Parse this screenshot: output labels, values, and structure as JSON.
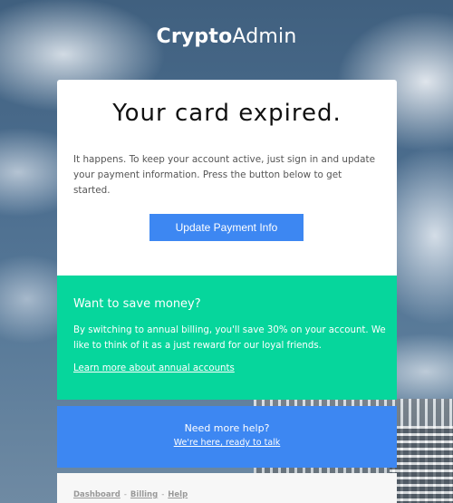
{
  "brand": {
    "bold": "Crypto",
    "light": "Admin"
  },
  "card": {
    "title": "Your card expired.",
    "body": "It happens. To keep your account active, just sign in and update your payment information. Press the button below to get started.",
    "button_label": "Update Payment Info"
  },
  "promo": {
    "title": "Want to save money?",
    "body": "By switching to annual billing, you'll save 30% on your account. We like to think of it as a just reward for our loyal friends.",
    "link": "Learn more about annual accounts"
  },
  "help": {
    "title": "Need more help?",
    "link": "We're here, ready to talk"
  },
  "footer": {
    "links": [
      "Dashboard",
      "Billing",
      "Help"
    ],
    "separator": "-"
  },
  "colors": {
    "button": "#3d87f2",
    "promo": "#06d69c",
    "help": "#3d87f2"
  }
}
